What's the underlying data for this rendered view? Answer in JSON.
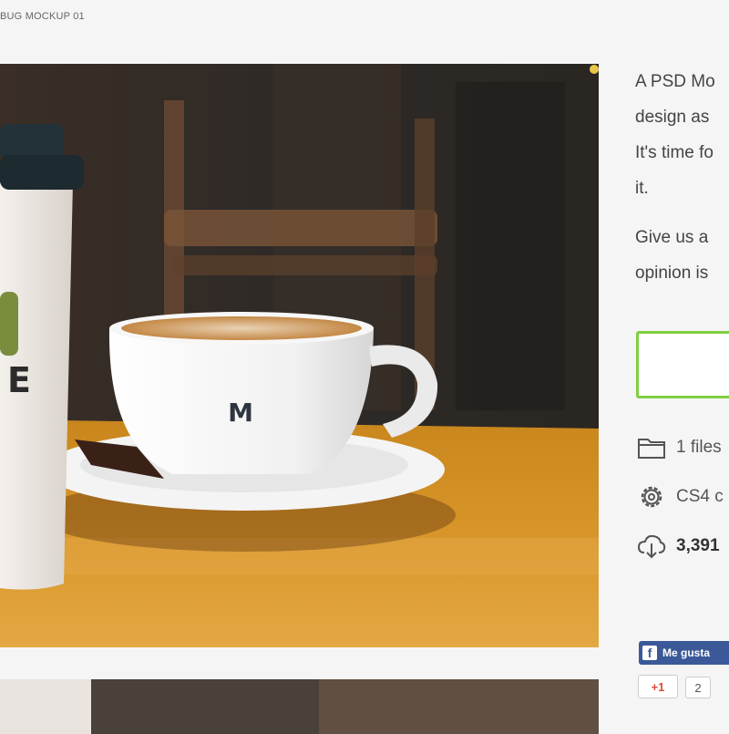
{
  "breadcrumb": "BUG MOCKUP 01",
  "description": {
    "lines_p1": [
      "A PSD Mo",
      "design as",
      "It's time fo",
      "it."
    ],
    "lines_p2": [
      "Give us a",
      "opinion is"
    ]
  },
  "download_button": {
    "label": ""
  },
  "meta": {
    "files": "1 files",
    "version": "CS4 c",
    "downloads": "3,391"
  },
  "social": {
    "facebook_like": "Me gusta",
    "gplus_label": "+1",
    "gplus_count": "2"
  },
  "mug_logo": "M",
  "cup_print": "E",
  "colors": {
    "accent_green": "#7fcf3f",
    "facebook_blue": "#3b5998",
    "gplus_red": "#dd4b39"
  },
  "icons": [
    "folder-icon",
    "gear-icon",
    "cloud-download-icon",
    "facebook-icon"
  ]
}
